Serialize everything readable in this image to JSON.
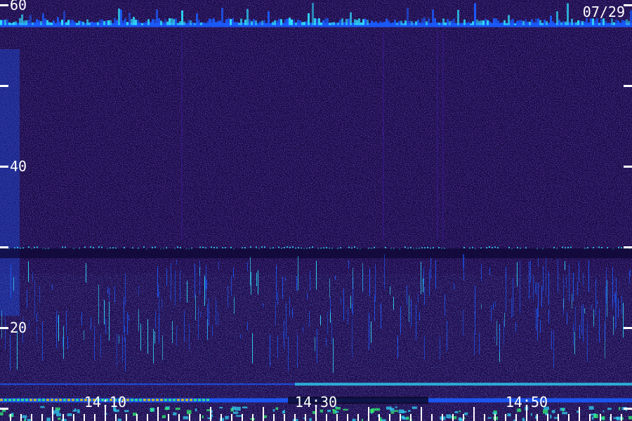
{
  "chart_data": {
    "type": "heatmap",
    "date_label": "07/29",
    "y_axis": {
      "range": [
        0,
        60
      ],
      "ticks": [
        10,
        20,
        30,
        40,
        50,
        60
      ],
      "labeled_ticks": [
        "20",
        "40",
        "60"
      ]
    },
    "x_axis": {
      "start": "14:01",
      "end": "14:59",
      "labeled_ticks": [
        "14:10",
        "14:30",
        "14:50"
      ]
    },
    "bands": [
      {
        "level": 57.5,
        "note": "bright continuous line"
      },
      {
        "level": 30.0,
        "note": "cyan dotted line"
      },
      {
        "level": 13.0,
        "note": "cyan line"
      },
      {
        "level": 11.0,
        "note": "green/yellow emission"
      }
    ],
    "colors": {
      "background": "#170a45",
      "noise_violet": "#3a1aa0",
      "band_blue": "#1a5cff",
      "band_cyan": "#2fe0ff",
      "band_green": "#30ff70",
      "band_yellow": "#e6d000",
      "tick": "#ffffff",
      "label": "#ffffff"
    }
  }
}
